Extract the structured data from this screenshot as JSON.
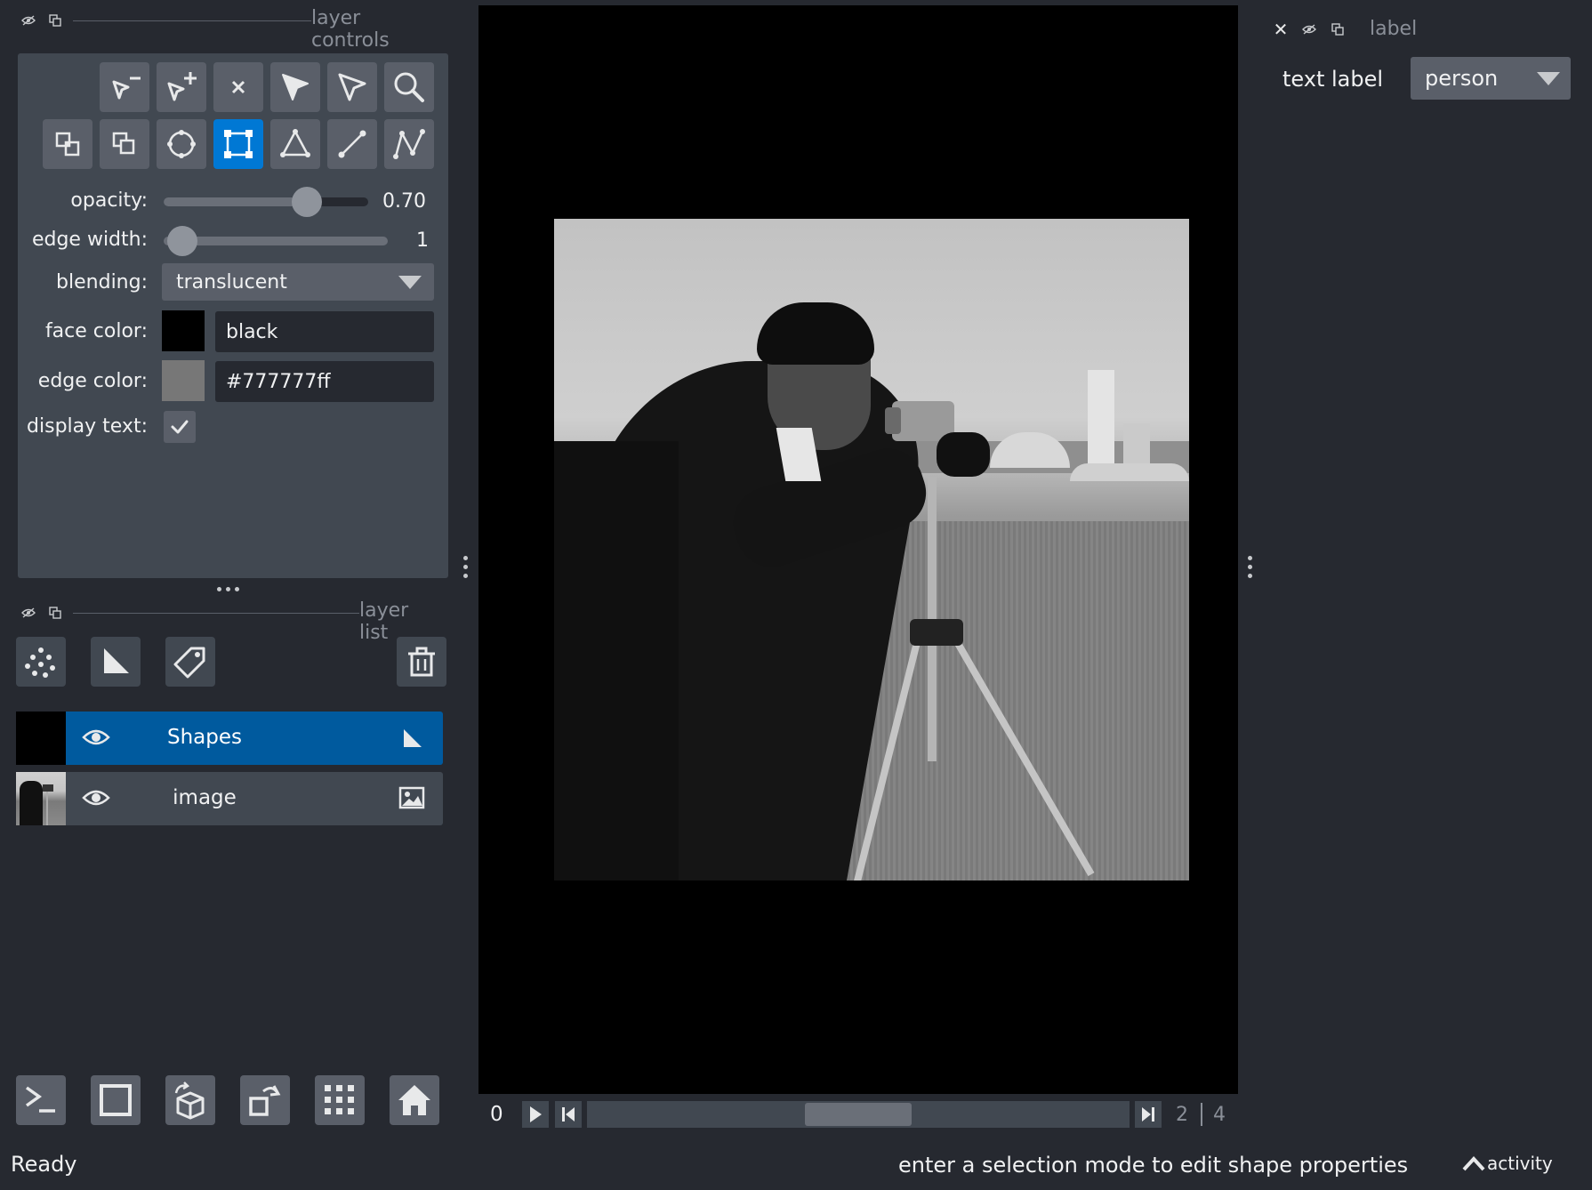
{
  "layer_controls": {
    "title": "layer controls",
    "tools": [
      {
        "icon": "remove-vertex-icon"
      },
      {
        "icon": "add-vertex-icon"
      },
      {
        "icon": "delete-shape-icon"
      },
      {
        "icon": "select-icon"
      },
      {
        "icon": "direct-select-icon"
      },
      {
        "icon": "zoom-icon"
      },
      {
        "icon": "move-back-icon"
      },
      {
        "icon": "move-front-icon"
      },
      {
        "icon": "ellipse-icon"
      },
      {
        "icon": "rectangle-icon",
        "active": true
      },
      {
        "icon": "polygon-icon"
      },
      {
        "icon": "line-icon"
      },
      {
        "icon": "path-icon"
      }
    ],
    "opacity_label": "opacity:",
    "opacity_value": "0.70",
    "opacity_fraction": 0.7,
    "edge_width_label": "edge width:",
    "edge_width_value": "1",
    "blending_label": "blending:",
    "blending_value": "translucent",
    "face_color_label": "face color:",
    "face_color_value": "black",
    "face_color_swatch": "#000000",
    "edge_color_label": "edge color:",
    "edge_color_value": "#777777ff",
    "edge_color_swatch": "#777777",
    "display_text_label": "display text:",
    "display_text_checked": true
  },
  "layer_list": {
    "title": "layer list",
    "layers": [
      {
        "name": "Shapes",
        "selected": true,
        "type_icon": "shapes-icon"
      },
      {
        "name": "image",
        "selected": false,
        "type_icon": "image-icon"
      }
    ]
  },
  "label_panel": {
    "title": "label",
    "text_label": "text label",
    "label_value": "person"
  },
  "dims": {
    "current_step": "0",
    "position": "2",
    "total": "4",
    "slider_fraction": 0.5
  },
  "status": {
    "ready": "Ready",
    "message": "enter a selection mode to edit shape properties",
    "activity": "activity"
  },
  "colors": {
    "accent": "#0078d4",
    "background": "#262930",
    "panel": "#414851",
    "button": "#5a5f69"
  }
}
